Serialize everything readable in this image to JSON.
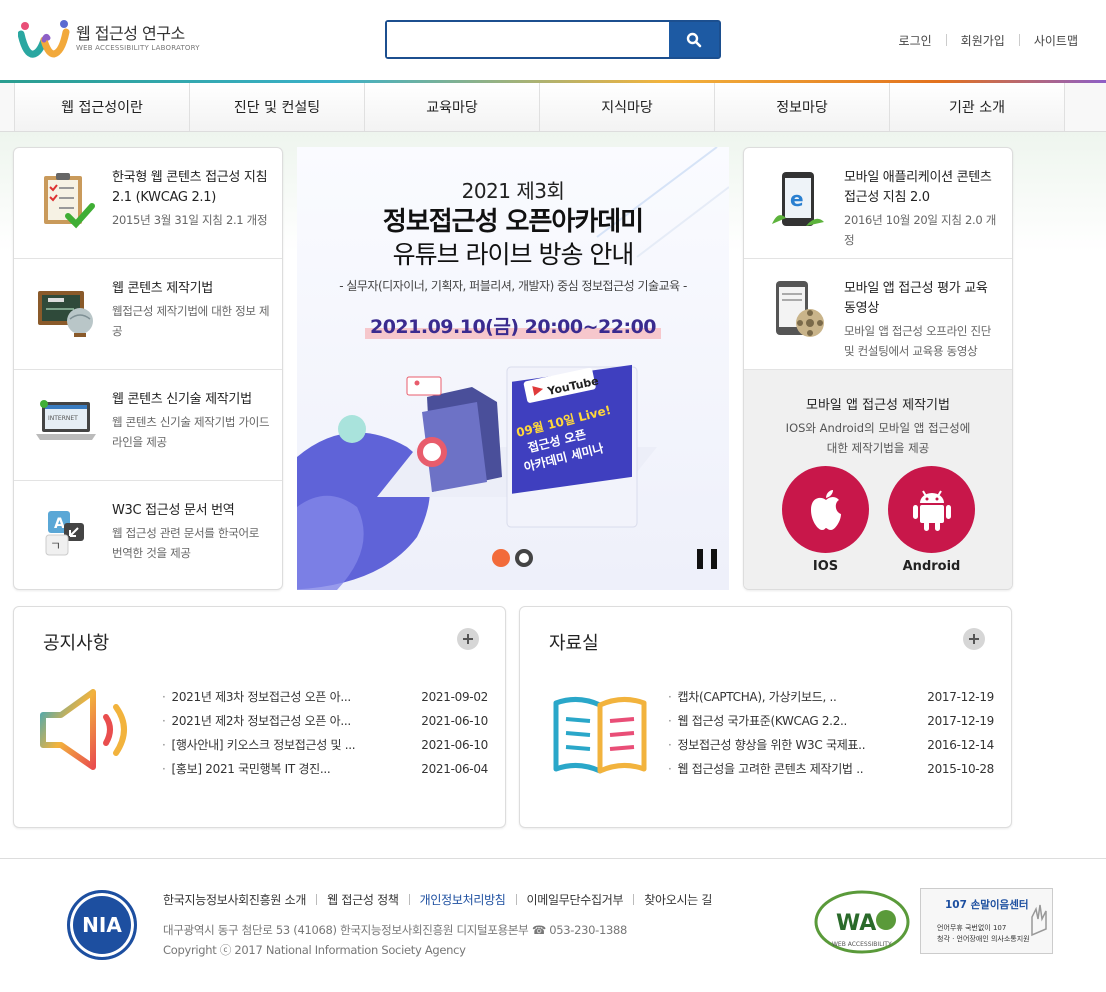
{
  "header": {
    "logo_title": "웹 접근성 연구소",
    "logo_sub": "WEB ACCESSIBILITY LABORATORY",
    "search_placeholder": "",
    "util_links": [
      "로그인",
      "회원가입",
      "사이트맵"
    ]
  },
  "nav": {
    "items": [
      "웹 접근성이란",
      "진단 및 컨설팅",
      "교육마당",
      "지식마당",
      "정보마당",
      "기관 소개"
    ]
  },
  "left_list": [
    {
      "title": "한국형 웹 콘텐츠 접근성 지침 2.1 (KWCAG 2.1)",
      "desc": "2015년 3월 31일 지침 2.1 개정"
    },
    {
      "title": "웹 콘텐츠 제작기법",
      "desc": "웹접근성 제작기법에 대한 정보 제공"
    },
    {
      "title": "웹 콘텐츠 신기술 제작기법",
      "desc": "웹 콘텐츠 신기술 제작기법 가이드라인을 제공"
    },
    {
      "title": "W3C 접근성 문서 번역",
      "desc": "웹 접근성 관련 문서를 한국어로 번역한 것을 제공"
    }
  ],
  "banner": {
    "year": "2021 제3회",
    "title1": "정보접근성 오픈아카데미",
    "title2": "유튜브 라이브 방송 안내",
    "subtitle": "- 실무자(디자이너, 기획자, 퍼블리셔, 개발자) 중심 정보접근성 기술교육 -",
    "datetime": "2021.09.10(금) 20:00~22:00",
    "youtube": "YouTube",
    "screen_text": [
      "09월 10일 Live!",
      "접근성 오픈",
      "아카데미 세미나"
    ],
    "colors": {
      "active_dot": "#f26b3a",
      "accent": "#3a2b8f"
    }
  },
  "right_list": [
    {
      "title": "모바일 애플리케이션 콘텐츠 접근성 지침 2.0",
      "desc": "2016년 10월 20일 지침 2.0 개정"
    },
    {
      "title": "모바일 앱 접근성 평가 교육 동영상",
      "desc": "모바일 앱 접근성 오프라인 진단 및 컨설팅에서 교육용 동영상"
    }
  ],
  "app_panel": {
    "title": "모바일 앱 접근성 제작기법",
    "desc1": "IOS와 Android의 모바일 앱 접근성에",
    "desc2": "대한 제작기법을 제공",
    "ios_label": "IOS",
    "android_label": "Android",
    "color": "#c8174a"
  },
  "notice": {
    "title": "공지사항",
    "items": [
      {
        "text": "2021년 제3차 정보접근성 오픈 아...",
        "date": "2021-09-02"
      },
      {
        "text": "2021년 제2차 정보접근성 오픈 아...",
        "date": "2021-06-10"
      },
      {
        "text": "[행사안내] 키오스크 정보접근성 및 ...",
        "date": "2021-06-10"
      },
      {
        "text": "[홍보] 2021 국민행복 IT 경진...",
        "date": "2021-06-04"
      }
    ]
  },
  "archive": {
    "title": "자료실",
    "items": [
      {
        "text": "캡차(CAPTCHA), 가상키보드, ..",
        "date": "2017-12-19"
      },
      {
        "text": "웹 접근성 국가표준(KWCAG 2.2..",
        "date": "2017-12-19"
      },
      {
        "text": "정보접근성 향상을 위한 W3C 국제표..",
        "date": "2016-12-14"
      },
      {
        "text": "웹 접근성을 고려한 콘텐츠 제작기법 ..",
        "date": "2015-10-28"
      }
    ]
  },
  "footer": {
    "links": [
      "한국지능정보사회진흥원 소개",
      "웹 접근성 정책",
      "개인정보처리방침",
      "이메일무단수집거부",
      "찾아오시는 길"
    ],
    "address": "대구광역시 동구 첨단로 53 (41068) 한국지능정보사회진흥원 디지털포용본부 ☎ 053-230-1388",
    "copyright": "Copyright ⓒ 2017 National Information Society Agency",
    "nia": "NIA",
    "wa_text": "WA",
    "wa_sub": "WEB ACCESSIBILITY",
    "c107_title": "107 손말이음센터",
    "c107_sub1": "언어무휴 국번없이 107",
    "c107_sub2": "청각 · 언어장애인 의사소통지원"
  }
}
